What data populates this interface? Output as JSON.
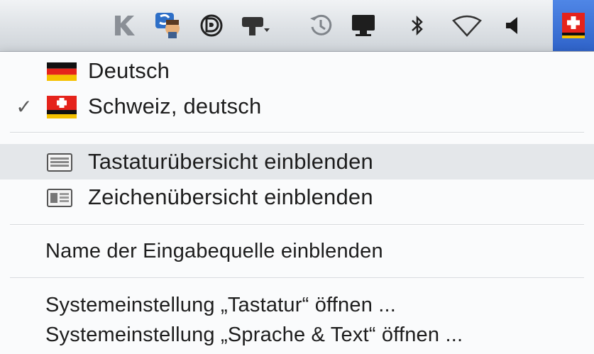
{
  "menubar": {
    "items": [
      {
        "icon": "k-icon"
      },
      {
        "icon": "script-avatar-icon"
      },
      {
        "icon": "d-circle-icon"
      },
      {
        "icon": "display-mirror-icon"
      },
      {
        "icon": "time-machine-icon"
      },
      {
        "icon": "monitor-icon"
      },
      {
        "icon": "bluetooth-icon"
      },
      {
        "icon": "wifi-icon"
      },
      {
        "icon": "volume-icon"
      },
      {
        "icon": "swiss-flag-icon",
        "active": true
      }
    ]
  },
  "menu": {
    "input_sources": [
      {
        "label": "Deutsch",
        "flag": "german-flag-icon",
        "checked": false
      },
      {
        "label": "Schweiz, deutsch",
        "flag": "swiss-flag-icon",
        "checked": true
      }
    ],
    "check_mark": "✓",
    "viewers": [
      {
        "label": "Tastaturübersicht einblenden",
        "icon": "keyboard-viewer-icon"
      },
      {
        "label": "Zeichenübersicht einblenden",
        "icon": "character-viewer-icon"
      }
    ],
    "show_name": "Name der Eingabequelle einblenden",
    "prefs": [
      {
        "label": "Systemeinstellung „Tastatur“ öffnen ..."
      },
      {
        "label": "Systemeinstellung „Sprache & Text“ öffnen ..."
      }
    ]
  },
  "colors": {
    "menubar_active": "#2f63c9",
    "flag_red": "#e5231b",
    "flag_gold": "#f5c100"
  }
}
